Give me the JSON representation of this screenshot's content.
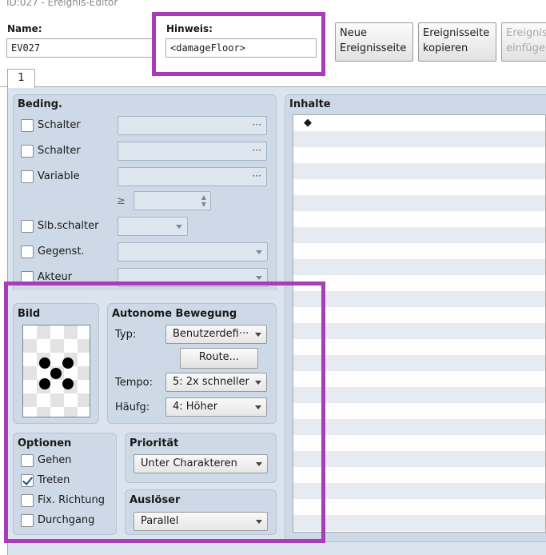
{
  "window": {
    "title": "ID:027 - Ereignis-Editor"
  },
  "header": {
    "name_label": "Name:",
    "name_value": "EV027",
    "note_label": "Hinweis:",
    "note_value": "<damageFloor>",
    "buttons": {
      "new_page": [
        "Neue",
        "Ereignisseite"
      ],
      "copy_page": [
        "Ereignisseite",
        "kopieren"
      ],
      "paste_page": [
        "Ereignis",
        "einfüge"
      ]
    }
  },
  "tabs": [
    "1"
  ],
  "conditions": {
    "title": "Beding.",
    "switch1_label": "Schalter",
    "switch2_label": "Schalter",
    "variable_label": "Variable",
    "ge_symbol": "≥",
    "self_switch_label": "Slb.schalter",
    "item_label": "Gegenst.",
    "actor_label": "Akteur",
    "dots": "···"
  },
  "image": {
    "title": "Bild"
  },
  "autonomous_movement": {
    "title": "Autonome Bewegung",
    "type_label": "Typ:",
    "type_value": "Benutzerdefi···",
    "route_button": "Route...",
    "speed_label": "Tempo:",
    "speed_value": "5: 2x schneller",
    "freq_label": "Häufg:",
    "freq_value": "4: Höher"
  },
  "options": {
    "title": "Optionen",
    "items": [
      {
        "label": "Gehen",
        "checked": false
      },
      {
        "label": "Treten",
        "checked": true
      },
      {
        "label": "Fix. Richtung",
        "checked": false
      },
      {
        "label": "Durchgang",
        "checked": false
      }
    ]
  },
  "priority": {
    "title": "Priorität",
    "value": "Unter Charakteren"
  },
  "trigger": {
    "title": "Auslöser",
    "value": "Parallel"
  },
  "contents": {
    "title": "Inhalte",
    "first_row": "◆"
  },
  "colors": {
    "highlight": "#a93cb7",
    "panel": "#cdd9e7",
    "list_alt": "#e6ebf2"
  }
}
